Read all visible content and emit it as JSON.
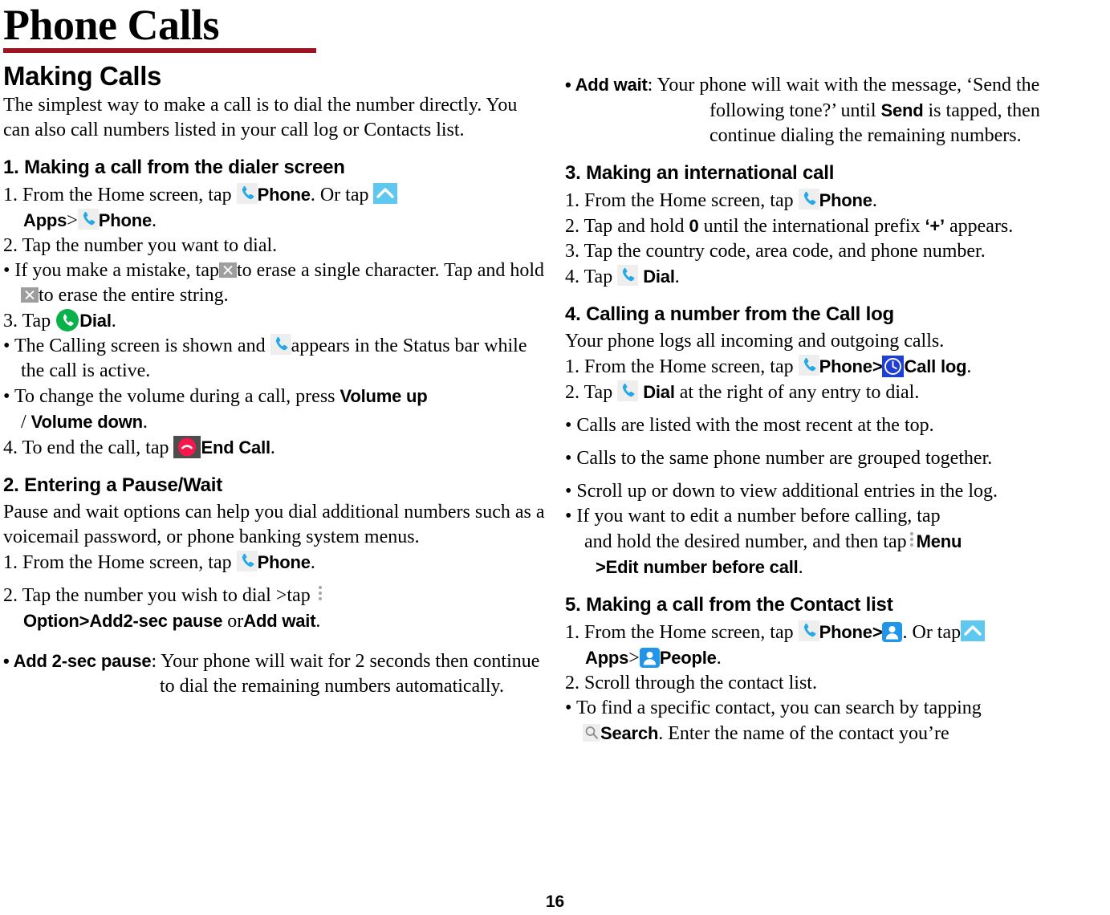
{
  "document": {
    "title": "Phone Calls",
    "page_number": "16",
    "accent_color": "#9b1420"
  },
  "icons": {
    "phone": "phone-handset-icon",
    "apps": "apps-chevron-up-icon",
    "erase": "backspace-erase-icon",
    "dial": "dial-green-circle-icon",
    "end_call": "end-call-red-icon",
    "menu": "menu-three-dots-icon",
    "call_log": "call-log-clock-icon",
    "people": "people-contact-icon",
    "search": "search-magnifier-icon"
  },
  "colors": {
    "phone_blue": "#23a8e8",
    "apps_blue": "#5ec8f0",
    "dial_green": "#09b14b",
    "end_call_red": "#f6174d",
    "end_call_bg": "#4d4d4d",
    "clock_blue": "#1e3fd4",
    "people_blue": "#2196e8",
    "erase_gray": "#9e9e9e",
    "menu_dot_gray": "#a8a8a8"
  },
  "left_column": {
    "section_heading": "Making Calls",
    "intro": "The simplest way to make a call is to dial the number directly. You can also call numbers listed in your call log or Contacts list.",
    "step1": {
      "heading": "1. Making a call from the dialer screen",
      "item1_a": "1. From the Home screen, tap",
      "item1_phone": "Phone",
      "item1_b": ". Or tap",
      "item1_apps": "Apps",
      "item1_gt": ">",
      "item1_phone2": "Phone",
      "item1_end": ".",
      "item2": "2. Tap the number you want to dial.",
      "bullet1_a": "• If you make a mistake, tap",
      "bullet1_b": "to erase a single character. Tap and hold",
      "bullet1_c": "to erase the entire string.",
      "item3_a": "3. Tap",
      "item3_dial": "Dial",
      "item3_end": ".",
      "bullet2_a": "• The Calling screen is shown and",
      "bullet2_b": "appears in the Status bar while the call is active.",
      "bullet3_a": "• To change the volume during a call, press",
      "bullet3_vol_up": "Volume up",
      "bullet3_slash": "/",
      "bullet3_vol_down": "Volume down",
      "bullet3_end": ".",
      "item4_a": "4. To end the call, tap",
      "item4_end_call": "End Call",
      "item4_end": "."
    },
    "step2": {
      "heading": "2. Entering a Pause/Wait",
      "intro": "Pause and wait options can help you dial additional numbers such as a voicemail password, or phone banking system menus.",
      "item1_a": "1. From the Home screen, tap",
      "item1_phone": "Phone",
      "item1_end": ".",
      "item2_a": "2. Tap the number you wish to dial >tap",
      "item2_option": "Option",
      "item2_gt": ">",
      "item2_add2sec": "Add2-sec pause",
      "item2_or": "or",
      "item2_addwait": "Add wait",
      "item2_end": ".",
      "bullet_label": "• Add 2-sec pause",
      "bullet_text": ": Your phone will wait for 2 seconds then continue to dial the remaining numbers automatically."
    }
  },
  "right_column": {
    "add_wait": {
      "label": "• Add wait",
      "text_a": ": Your phone will wait with the message, ‘Send the following tone?’ until",
      "send": "Send",
      "text_b": "is tapped, then continue dialing the remaining numbers."
    },
    "step3": {
      "heading": "3. Making an international call",
      "item1_a": "1. From the Home screen, tap",
      "item1_phone": "Phone",
      "item1_end": ".",
      "item2_a": "2. Tap and hold",
      "item2_zero": "0",
      "item2_b": "until the international prefix",
      "item2_plus": "‘+’",
      "item2_c": "appears.",
      "item3": "3. Tap the country code, area code, and phone number.",
      "item4_a": "4. Tap",
      "item4_dial": "Dial",
      "item4_end": "."
    },
    "step4": {
      "heading": "4. Calling a number from the Call log",
      "intro": "Your phone logs all incoming and outgoing calls.",
      "item1_a": "1. From the Home screen, tap",
      "item1_phone": "Phone",
      "item1_gt": ">",
      "item1_calllog": "Call log",
      "item1_end": ".",
      "item2_a": "2. Tap",
      "item2_dial": "Dial",
      "item2_b": "at the right of any entry to dial.",
      "bullet1": "• Calls are listed with the most recent at the top.",
      "bullet2": "• Calls to the same phone number are grouped together.",
      "bullet3": "• Scroll up or down to view additional entries in the log.",
      "bullet4_a": "• If you want to edit a number before calling, tap",
      "bullet4_b": "and hold the desired number, and then tap",
      "bullet4_menu": "Menu",
      "bullet4_gt": ">",
      "bullet4_edit": "Edit number before call",
      "bullet4_end": "."
    },
    "step5": {
      "heading": "5. Making a call from the Contact list",
      "item1_a": "1. From the Home screen, tap",
      "item1_phone": "Phone",
      "item1_gt": ">",
      "item1_b": ". Or tap",
      "item1_apps": "Apps",
      "item1_gt2": ">",
      "item1_people": "People",
      "item1_end": ".",
      "item2": "2. Scroll through the contact list.",
      "bullet1_a": "• To find a specific contact, you can search by tapping",
      "bullet1_search": "Search",
      "bullet1_b": ". Enter the name of the contact you’re"
    }
  }
}
